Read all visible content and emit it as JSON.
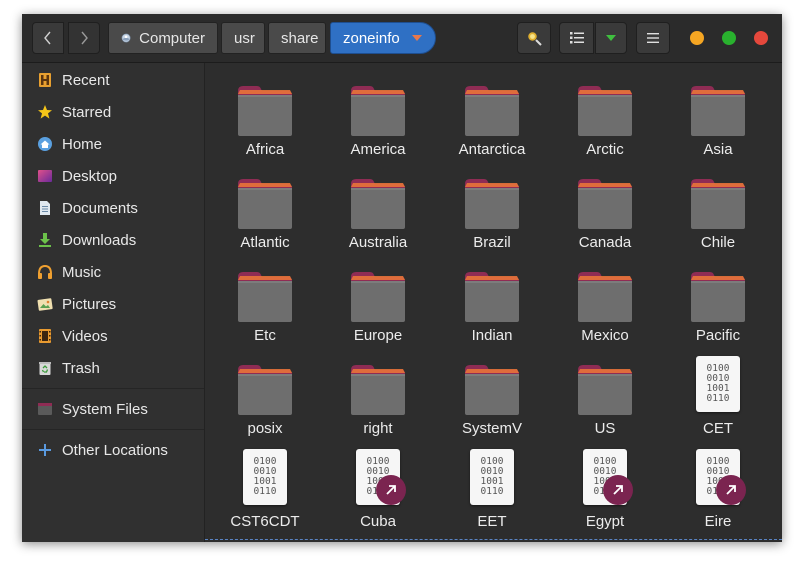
{
  "header": {
    "breadcrumbs": [
      {
        "label": "Computer",
        "icon": "drive-icon"
      },
      {
        "label": "usr"
      },
      {
        "label": "share"
      },
      {
        "label": "zoneinfo",
        "active": true
      }
    ]
  },
  "colors": {
    "accent": "#2f70c4",
    "close": "#e5483c",
    "maximize": "#29b12e",
    "minimize": "#f5a623",
    "folder_tab": "#8f2c54",
    "folder_body": "#6e6e6e",
    "link_badge": "#7b2450"
  },
  "sidebar": {
    "items": [
      {
        "label": "Recent",
        "icon": "recent-icon"
      },
      {
        "label": "Starred",
        "icon": "star-icon"
      },
      {
        "label": "Home",
        "icon": "home-icon"
      },
      {
        "label": "Desktop",
        "icon": "desktop-icon"
      },
      {
        "label": "Documents",
        "icon": "documents-icon"
      },
      {
        "label": "Downloads",
        "icon": "downloads-icon"
      },
      {
        "label": "Music",
        "icon": "music-icon"
      },
      {
        "label": "Pictures",
        "icon": "pictures-icon"
      },
      {
        "label": "Videos",
        "icon": "videos-icon"
      },
      {
        "label": "Trash",
        "icon": "trash-icon"
      },
      {
        "label": "System Files",
        "icon": "system-files-icon"
      },
      {
        "label": "Other Locations",
        "icon": "plus-icon"
      }
    ]
  },
  "content": {
    "binary_text": "0100\n0010\n1001\n0110",
    "items": [
      {
        "label": "Africa",
        "type": "folder"
      },
      {
        "label": "America",
        "type": "folder"
      },
      {
        "label": "Antarctica",
        "type": "folder"
      },
      {
        "label": "Arctic",
        "type": "folder"
      },
      {
        "label": "Asia",
        "type": "folder"
      },
      {
        "label": "Atlantic",
        "type": "folder"
      },
      {
        "label": "Australia",
        "type": "folder"
      },
      {
        "label": "Brazil",
        "type": "folder"
      },
      {
        "label": "Canada",
        "type": "folder"
      },
      {
        "label": "Chile",
        "type": "folder"
      },
      {
        "label": "Etc",
        "type": "folder"
      },
      {
        "label": "Europe",
        "type": "folder"
      },
      {
        "label": "Indian",
        "type": "folder"
      },
      {
        "label": "Mexico",
        "type": "folder"
      },
      {
        "label": "Pacific",
        "type": "folder"
      },
      {
        "label": "posix",
        "type": "folder"
      },
      {
        "label": "right",
        "type": "folder"
      },
      {
        "label": "SystemV",
        "type": "folder"
      },
      {
        "label": "US",
        "type": "folder"
      },
      {
        "label": "CET",
        "type": "file"
      },
      {
        "label": "CST6CDT",
        "type": "file"
      },
      {
        "label": "Cuba",
        "type": "file",
        "symlink": true
      },
      {
        "label": "EET",
        "type": "file"
      },
      {
        "label": "Egypt",
        "type": "file",
        "symlink": true
      },
      {
        "label": "Eire",
        "type": "file",
        "symlink": true
      }
    ]
  }
}
